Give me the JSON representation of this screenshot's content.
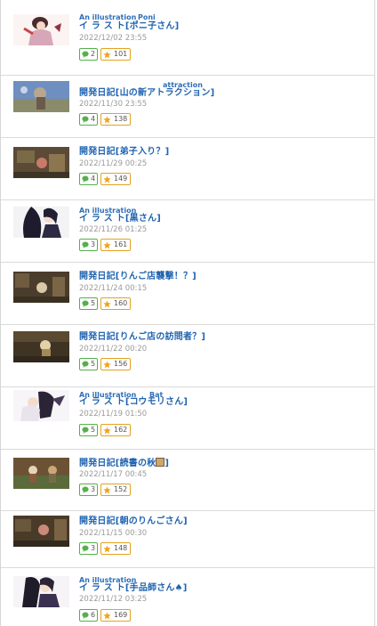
{
  "colors": {
    "title": "#1f63b0",
    "comment_border": "#55b04b",
    "star_border": "#e3a320",
    "date": "#9a9a9a"
  },
  "icons": {
    "comment": "speech-bubble-icon",
    "star": "star-icon",
    "book": "book-emoji-icon",
    "spade": "spade-symbol"
  },
  "entries": [
    {
      "ruby1": "An illustration",
      "ruby2": "Poni",
      "title": "イ ラ ス ト[ポニ子さん]",
      "date": "2022/12/02 23:55",
      "comments": "2",
      "stars": "101"
    },
    {
      "ruby1": "",
      "ruby2": "attraction",
      "title": "開発日記[山の新アトラクション]",
      "date": "2022/11/30 23:55",
      "comments": "4",
      "stars": "138"
    },
    {
      "ruby1": "",
      "ruby2": "",
      "title": "開発日記[弟子入り？]",
      "date": "2022/11/29 00:25",
      "comments": "4",
      "stars": "149"
    },
    {
      "ruby1": "An illustration",
      "ruby2": "",
      "title": "イ ラ ス ト[黒さん]",
      "date": "2022/11/26 01:25",
      "comments": "3",
      "stars": "161"
    },
    {
      "ruby1": "",
      "ruby2": "",
      "title": "開発日記[りんご店襲撃！？]",
      "date": "2022/11/24 00:15",
      "comments": "5",
      "stars": "160"
    },
    {
      "ruby1": "",
      "ruby2": "",
      "title": "開発日記[りんご店の訪問者？]",
      "date": "2022/11/22 00:20",
      "comments": "5",
      "stars": "156"
    },
    {
      "ruby1": "An illustration",
      "ruby2": "Bat",
      "title": "イ ラ ス ト[コウモリさん]",
      "date": "2022/11/19 01:50",
      "comments": "5",
      "stars": "162"
    },
    {
      "ruby1": "",
      "ruby2": "",
      "title": "開発日記[読書の秋",
      "title_end": "]",
      "date": "2022/11/17 00:45",
      "comments": "3",
      "stars": "152"
    },
    {
      "ruby1": "",
      "ruby2": "",
      "title": "開発日記[朝のりんごさん]",
      "date": "2022/11/15 00:30",
      "comments": "3",
      "stars": "148"
    },
    {
      "ruby1": "An illustration",
      "ruby2": "",
      "title": "イ ラ ス ト[手品師さん♠]",
      "date": "2022/11/12 03:25",
      "comments": "6",
      "stars": "169"
    }
  ]
}
